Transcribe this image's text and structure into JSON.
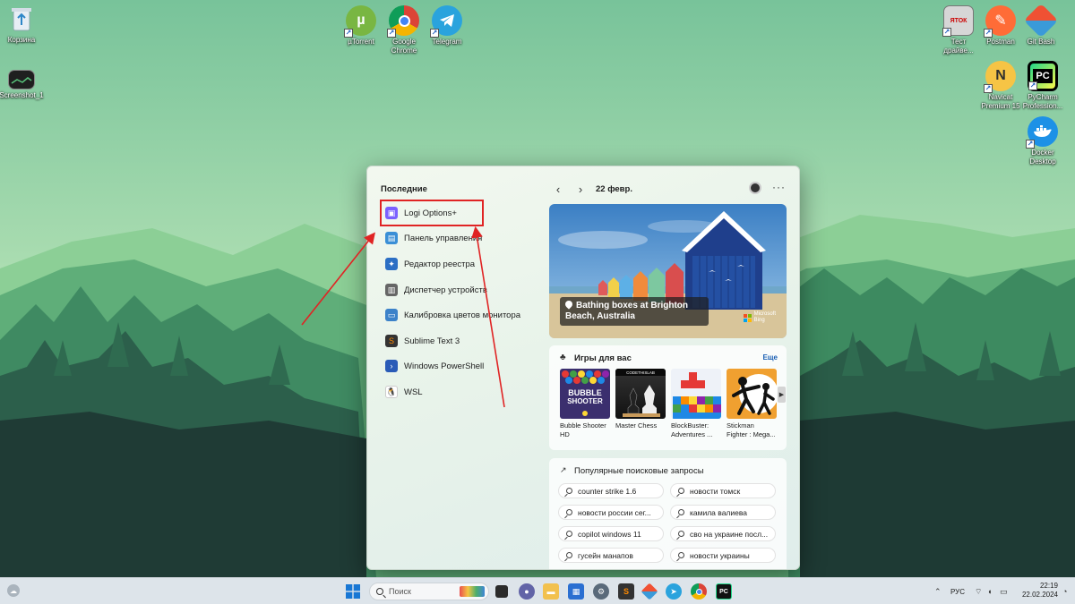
{
  "desktop": {
    "icons_left": [
      {
        "label": "Корзина",
        "icon": "recycle-bin-icon"
      },
      {
        "label": "Screenshot_1",
        "icon": "screenshot-file-icon"
      }
    ],
    "icons_top": [
      {
        "label": "µTorrent",
        "icon": "utorrent-icon"
      },
      {
        "label": "Google\nChrome",
        "icon": "chrome-icon"
      },
      {
        "label": "Telegram",
        "icon": "telegram-icon"
      }
    ],
    "icons_right": [
      {
        "label": "Тест\nдрайве...",
        "icon": "printer-test-icon"
      },
      {
        "label": "Postman",
        "icon": "postman-icon"
      },
      {
        "label": "Git Bash",
        "icon": "git-bash-icon"
      },
      {
        "label": "Navicat\nPremium 15",
        "icon": "navicat-icon"
      },
      {
        "label": "PyCharm\nProfession...",
        "icon": "pycharm-icon"
      },
      {
        "label": "Docker\nDesktop",
        "icon": "docker-icon"
      }
    ]
  },
  "start_menu": {
    "recent_title": "Последние",
    "recent_items": [
      {
        "label": "Logi Options+",
        "icon": "logi-options-icon",
        "color": "#7b61ff"
      },
      {
        "label": "Панель управления",
        "icon": "control-panel-icon",
        "color": "#3a8fd6"
      },
      {
        "label": "Редактор реестра",
        "icon": "registry-editor-icon",
        "color": "#2c6fc4"
      },
      {
        "label": "Диспетчер устройств",
        "icon": "device-manager-icon",
        "color": "#666666"
      },
      {
        "label": "Калибровка цветов монитора",
        "icon": "color-calibration-icon",
        "color": "#3c82c9"
      },
      {
        "label": "Sublime Text 3",
        "icon": "sublime-text-icon",
        "color": "#ff8a00"
      },
      {
        "label": "Windows PowerShell",
        "icon": "powershell-icon",
        "color": "#2a5bb7"
      },
      {
        "label": "WSL",
        "icon": "wsl-penguin-icon",
        "color": "#222222"
      }
    ],
    "feed": {
      "date": "22 февр.",
      "hero_caption": "Bathing boxes at Brighton Beach, Australia",
      "hero_brand_line1": "Microsoft",
      "hero_brand_line2": "Bing",
      "games_title": "Игры для вас",
      "games_more": "Еще",
      "games": [
        {
          "name": "Bubble Shooter\nHD",
          "thumb_text": "BUBBLE\nSHOOTER"
        },
        {
          "name": "Master Chess",
          "thumb_text": "CODETHISLAB"
        },
        {
          "name": "BlockBuster:\nAdventures ...",
          "thumb_text": ""
        },
        {
          "name": "Stickman\nFighter : Mega...",
          "thumb_text": ""
        }
      ],
      "trends_title": "Популярные поисковые запросы",
      "trends": [
        "counter strike 1.6",
        "новости томск",
        "новости россии сег...",
        "камила валиева",
        "copilot windows 11",
        "сво на украине посл...",
        "гусейн манапов",
        "новости украины"
      ]
    }
  },
  "taskbar": {
    "search_placeholder": "Поиск",
    "language": "РУС",
    "time": "22:19",
    "date": "22.02.2024",
    "pinned": [
      {
        "icon": "file-explorer-icon",
        "color": "#f2c14e"
      },
      {
        "icon": "microsoft-store-icon",
        "color": "#2b6fd1"
      },
      {
        "icon": "settings-gear-icon",
        "color": "#5a6a7a"
      },
      {
        "icon": "sublime-text-icon",
        "color": "#ff8a00"
      },
      {
        "icon": "git-icon",
        "color": "#3a9ad9"
      },
      {
        "icon": "telegram-icon",
        "color": "#2aa3dd"
      },
      {
        "icon": "chrome-icon",
        "color": "#dd4b3e"
      },
      {
        "icon": "pycharm-icon",
        "color": "#111111"
      }
    ]
  },
  "colors": {
    "annotation_red": "#e02424",
    "taskbar_bg": "#dde4ea"
  }
}
